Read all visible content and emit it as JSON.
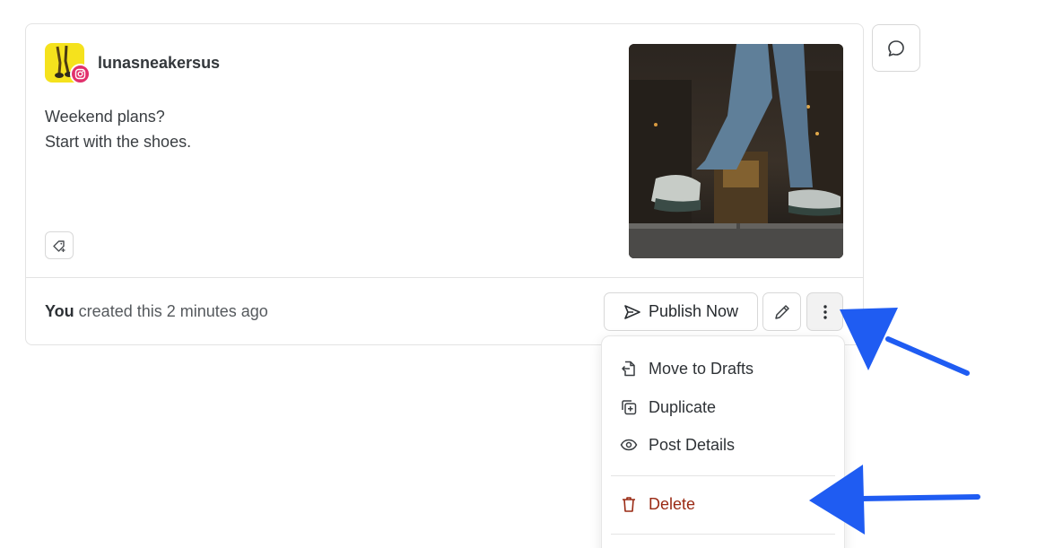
{
  "post": {
    "account_name": "lunasneakersus",
    "platform_icon": "instagram-icon",
    "caption_line1": "Weekend plans?",
    "caption_line2": "Start with the shoes.",
    "tag_icon": "tag-add-icon",
    "image_icon": "photo"
  },
  "footer": {
    "author": "You",
    "created_text": " created this 2 minutes ago",
    "publish_label": "Publish Now",
    "publish_icon": "send-icon",
    "edit_icon": "pencil-icon",
    "more_icon": "more-vertical-icon"
  },
  "side": {
    "comment_icon": "comment-icon"
  },
  "menu": {
    "items": [
      {
        "label": "Move to Drafts",
        "icon": "move-to-drafts-icon"
      },
      {
        "label": "Duplicate",
        "icon": "duplicate-icon"
      },
      {
        "label": "Post Details",
        "icon": "eye-icon"
      }
    ],
    "delete_label": "Delete",
    "delete_icon": "trash-icon"
  },
  "colors": {
    "annotation_arrow": "#1f5cf2",
    "danger": "#9a2a14",
    "instagram": "#e1306c",
    "avatar_bg": "#f5e21d"
  }
}
